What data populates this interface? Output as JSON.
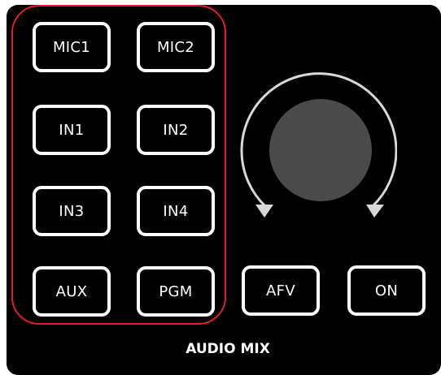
{
  "panel": {
    "title": "AUDIO MIX",
    "highlight_color": "#e41e26",
    "background_color": "#000000"
  },
  "source_buttons": [
    {
      "label": "MIC1"
    },
    {
      "label": "MIC2"
    },
    {
      "label": "IN1"
    },
    {
      "label": "IN2"
    },
    {
      "label": "IN3"
    },
    {
      "label": "IN4"
    },
    {
      "label": "AUX"
    },
    {
      "label": "PGM"
    }
  ],
  "control_buttons": [
    {
      "label": "AFV"
    },
    {
      "label": "ON"
    }
  ],
  "knob": {
    "icon": "rotary-knob-icon",
    "knob_color": "#4a4a4a",
    "arrow_color": "#d8d8d8"
  }
}
